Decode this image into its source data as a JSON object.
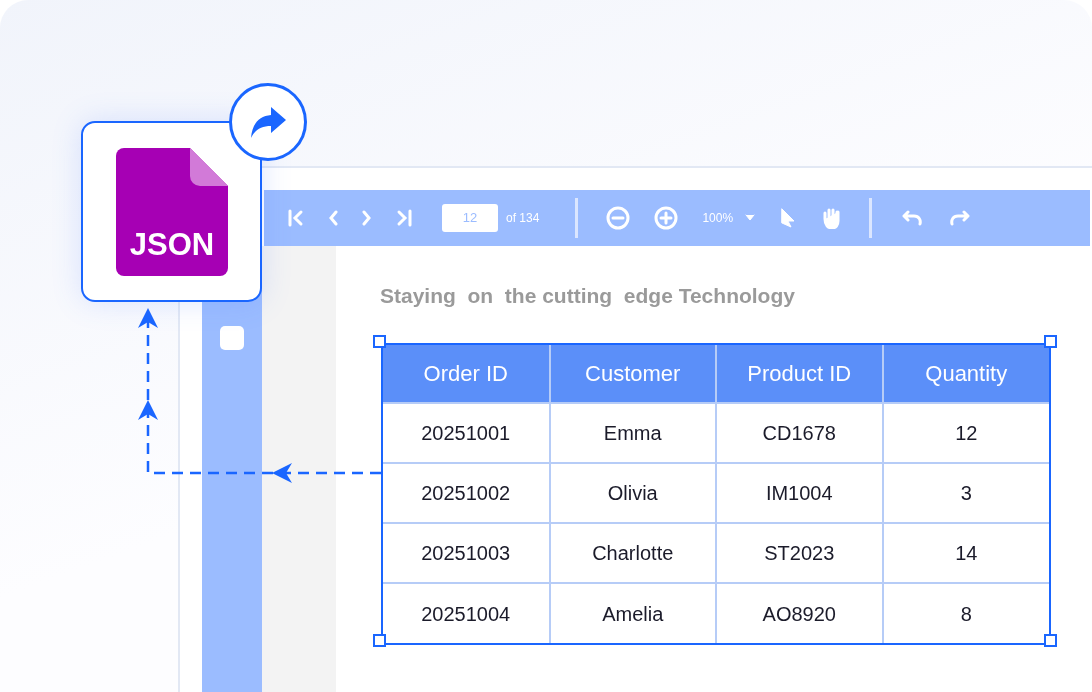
{
  "file_card": {
    "label": "JSON"
  },
  "toolbar": {
    "page": "12",
    "page_total": "of 134",
    "zoom": "100%"
  },
  "document": {
    "title": "Staying  on  the cutting  edge Technology"
  },
  "table": {
    "columns": [
      "Order ID",
      "Customer",
      "Product ID",
      "Quantity"
    ],
    "rows": [
      [
        "20251001",
        "Emma",
        "CD1678",
        "12"
      ],
      [
        "20251002",
        "Olivia",
        "IM1004",
        "3"
      ],
      [
        "20251003",
        "Charlotte",
        "ST2023",
        "14"
      ],
      [
        "20251004",
        "Amelia",
        "AO8920",
        "8"
      ]
    ]
  }
}
